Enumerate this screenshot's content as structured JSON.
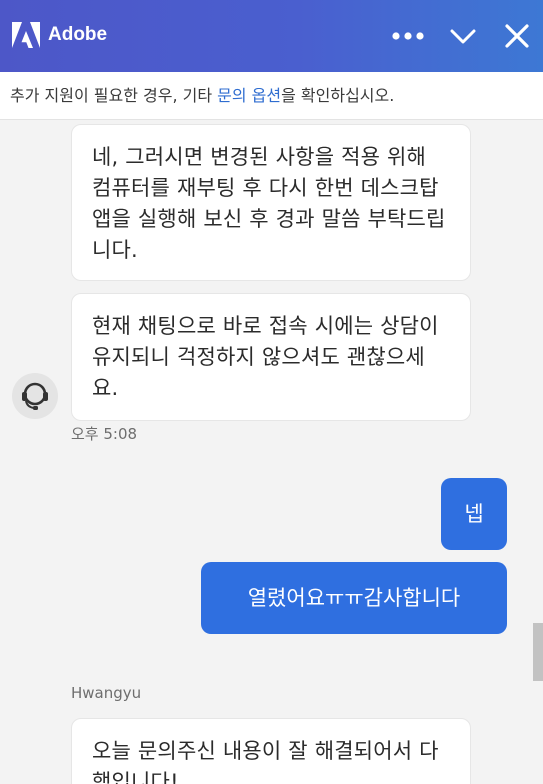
{
  "header": {
    "brand": "Adobe",
    "more_icon": "more-horizontal-icon",
    "minimize_icon": "chevron-down-icon",
    "close_icon": "close-icon"
  },
  "notice": {
    "prefix": "추가 지원이 필요한 경우, 기타 ",
    "link": "문의 옵션",
    "suffix": "을 확인하십시오."
  },
  "messages": {
    "agent_1": "네, 그러시면 변경된 사항을 적용 위해 컴퓨터를 재부팅 후 다시 한번 데스크탑 앱을 실행해 보신 후 경과 말씀 부탁드립니다.",
    "agent_2": "현재 채팅으로 바로 접속 시에는 상담이 유지되니 걱정하지 않으셔도 괜찮으세요.",
    "agent_time": "오후 5:08",
    "user_1": "넵",
    "user_2": "열렸어요ㅠㅠ감사합니다",
    "sender_name": "Hwangyu",
    "agent_3": "오늘 문의주신 내용이 잘 해결되어서 다행입니다!"
  },
  "colors": {
    "header_gradient_start": "#4d57c8",
    "header_gradient_end": "#3d78d4",
    "user_bubble": "#2f6fe0",
    "link": "#2f6dd0"
  }
}
